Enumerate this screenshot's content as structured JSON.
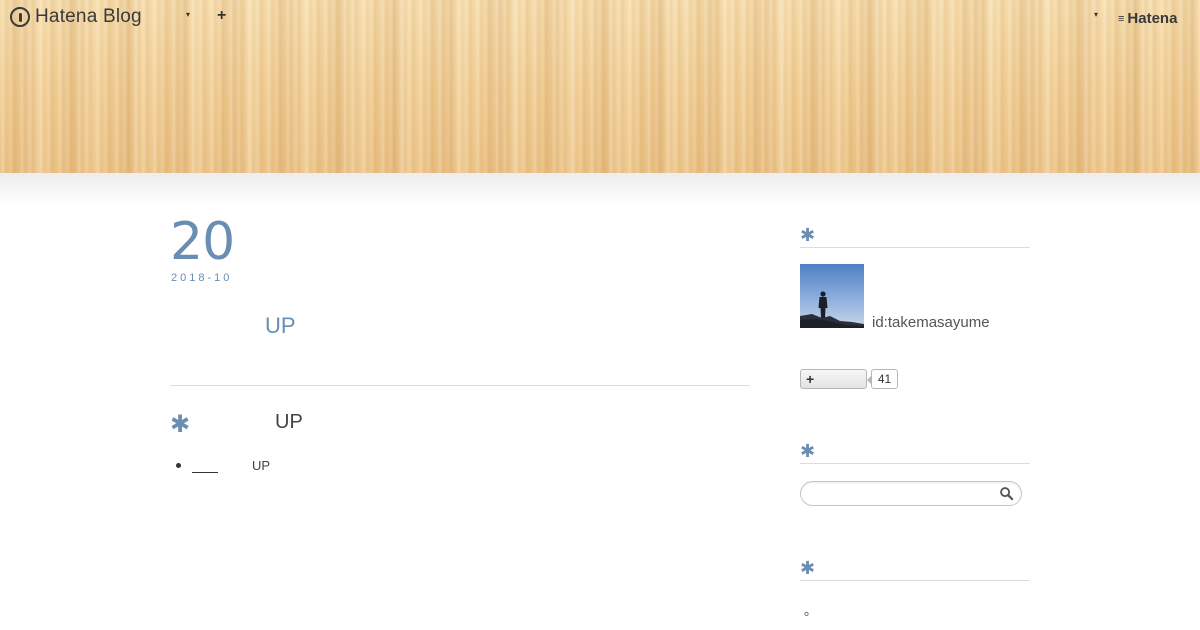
{
  "globalnav": {
    "logo_text": "Hatena Blog",
    "caret": "▾",
    "plus": "+",
    "hatena_text": "Hatena",
    "hatena_mark": "≡"
  },
  "entry": {
    "date_day": "20",
    "date_ym": "2018-10",
    "title": "UP",
    "section_asterisk": "✱",
    "section_heading": "UP",
    "list_items": [
      {
        "text": "UP"
      }
    ]
  },
  "sidebar": {
    "profile": {
      "asterisk": "✱",
      "user_id": "id:takemasayume",
      "subscribe_plus": "+",
      "subscriber_count": "41"
    },
    "search": {
      "asterisk": "✱",
      "placeholder": ""
    },
    "about": {
      "asterisk": "✱",
      "text": "。"
    }
  },
  "colors": {
    "accent": "#6a8db3",
    "wood": "#f2cf97"
  },
  "icons": {
    "logo": "hatena-blog-logo-icon",
    "search": "search-icon",
    "plus": "plus-icon",
    "caret": "chevron-down-icon"
  }
}
